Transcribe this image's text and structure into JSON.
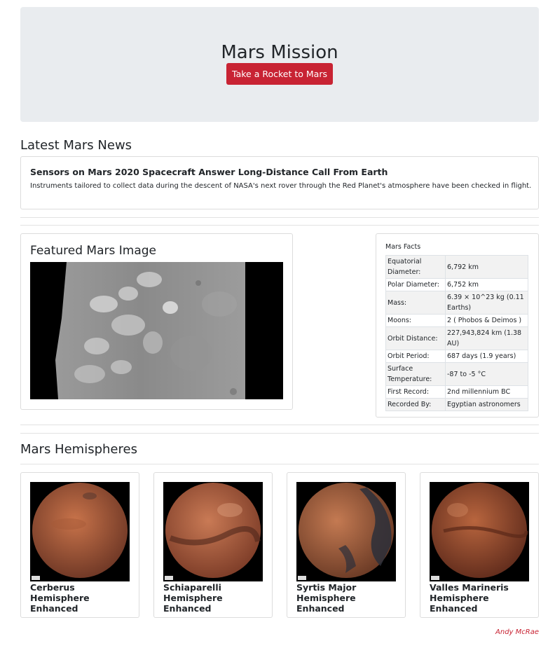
{
  "header": {
    "title": "Mars Mission",
    "button_label": "Take a Rocket to Mars"
  },
  "news": {
    "section_title": "Latest Mars News",
    "headline": "Sensors on Mars 2020 Spacecraft Answer Long-Distance Call From Earth",
    "teaser": "Instruments tailored to collect data during the descent of NASA's next rover through the Red Planet's atmosphere have been checked in flight."
  },
  "featured": {
    "title": "Featured Mars Image",
    "image_icon": "mars-surface-image"
  },
  "facts": {
    "title": "Mars Facts",
    "rows": [
      {
        "label": "Equatorial Diameter:",
        "value": "6,792 km"
      },
      {
        "label": "Polar Diameter:",
        "value": "6,752 km"
      },
      {
        "label": "Mass:",
        "value": "6.39 × 10^23 kg (0.11 Earths)"
      },
      {
        "label": "Moons:",
        "value": "2 ( Phobos & Deimos )"
      },
      {
        "label": "Orbit Distance:",
        "value": "227,943,824 km (1.38 AU)"
      },
      {
        "label": "Orbit Period:",
        "value": "687 days (1.9 years)"
      },
      {
        "label": "Surface Temperature:",
        "value": "-87 to -5 °C"
      },
      {
        "label": "First Record:",
        "value": "2nd millennium BC"
      },
      {
        "label": "Recorded By:",
        "value": "Egyptian astronomers"
      }
    ]
  },
  "hemispheres": {
    "section_title": "Mars Hemispheres",
    "items": [
      {
        "title": "Cerberus Hemisphere Enhanced",
        "base": "#c8734a",
        "dark": "#6b3524"
      },
      {
        "title": "Schiaparelli Hemisphere Enhanced",
        "base": "#c97a55",
        "dark": "#7a3a26"
      },
      {
        "title": "Syrtis Major Hemisphere Enhanced",
        "base": "#c47a52",
        "dark": "#2c2f3a"
      },
      {
        "title": "Valles Marineris Hemisphere Enhanced",
        "base": "#b8653e",
        "dark": "#5e2a1b"
      }
    ]
  },
  "footer": {
    "credit": "Andy McRae"
  },
  "colors": {
    "accent": "#c82333",
    "jumbotron": "#e9ecef"
  }
}
